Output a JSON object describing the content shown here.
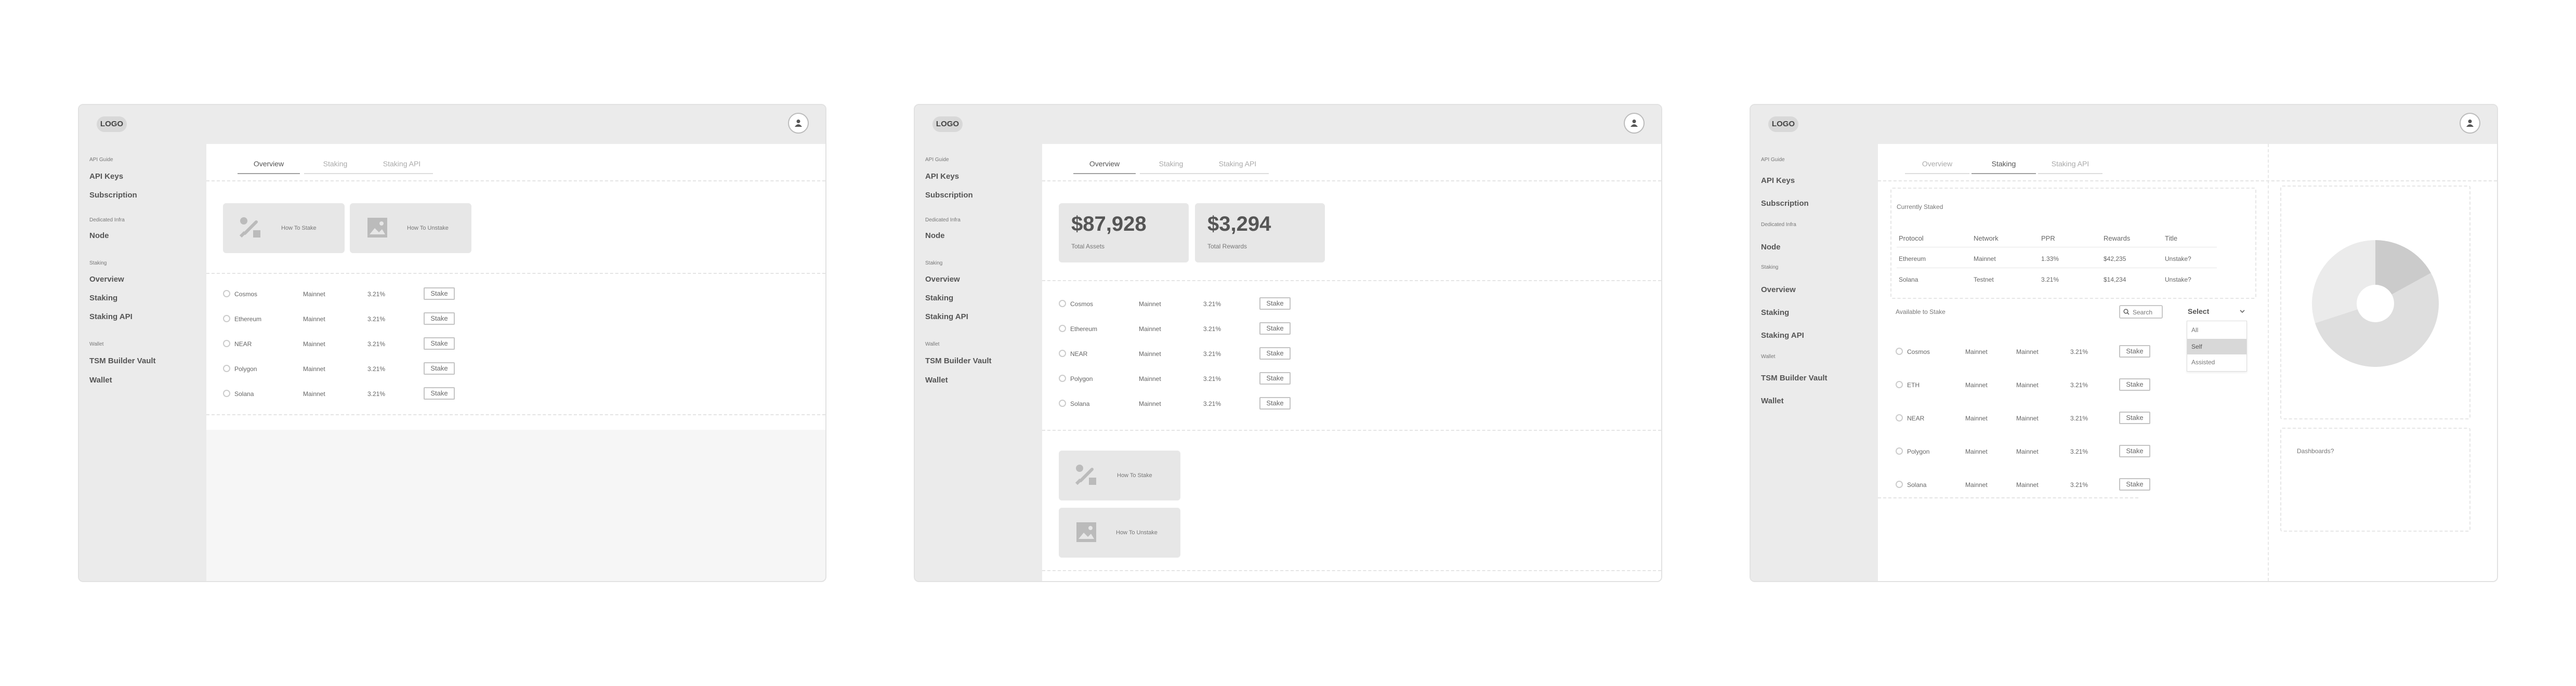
{
  "logo": "LOGO",
  "sidebar": {
    "api_guide": "API Guide",
    "api_keys": "API Keys",
    "subscription": "Subscription",
    "dedicated_infra": "Dedicated Infra",
    "node": "Node",
    "staking": "Staking",
    "overview": "Overview",
    "staking_item": "Staking",
    "staking_api": "Staking API",
    "wallet_header": "Wallet",
    "tsm_builder_vault": "TSM Builder Vault",
    "wallet": "Wallet"
  },
  "tabs": [
    "Overview",
    "Staking",
    "Staking API"
  ],
  "cards": {
    "how_to_stake": "How To Stake",
    "how_to_unstake": "How To Unstake"
  },
  "stats": {
    "total_assets_value": "$87,928",
    "total_assets_label": "Total Assets",
    "total_rewards_value": "$3,294",
    "total_rewards_label": "Total Rewards"
  },
  "stake_label": "Stake",
  "protocols": [
    {
      "name": "Cosmos",
      "network": "Mainnet",
      "apr": "3.21%"
    },
    {
      "name": "Ethereum",
      "network": "Mainnet",
      "apr": "3.21%"
    },
    {
      "name": "NEAR",
      "network": "Mainnet",
      "apr": "3.21%"
    },
    {
      "name": "Polygon",
      "network": "Mainnet",
      "apr": "3.21%"
    },
    {
      "name": "Solana",
      "network": "Mainnet",
      "apr": "3.21%"
    }
  ],
  "staking_page": {
    "currently_staked": "Currently Staked",
    "headers": [
      "Protocol",
      "Network",
      "PPR",
      "Rewards",
      "Title"
    ],
    "staked_rows": [
      {
        "protocol": "Ethereum",
        "network": "Mainnet",
        "ppr": "1.33%",
        "rewards": "$42,235",
        "title": "Unstake?"
      },
      {
        "protocol": "Solana",
        "network": "Testnet",
        "ppr": "3.21%",
        "rewards": "$14,234",
        "title": "Unstake?"
      }
    ],
    "available_to_stake": "Available to Stake",
    "search_placeholder": "Search",
    "select_label": "Select",
    "select_options": [
      "All",
      "Self",
      "Assisted"
    ],
    "selected_option": "Self",
    "available_rows": [
      {
        "name": "Cosmos",
        "col2": "Mainnet",
        "col3": "Mainnet",
        "apr": "3.21%"
      },
      {
        "name": "ETH",
        "col2": "Mainnet",
        "col3": "Mainnet",
        "apr": "3.21%"
      },
      {
        "name": "NEAR",
        "col2": "Mainnet",
        "col3": "Mainnet",
        "apr": "3.21%"
      },
      {
        "name": "Polygon",
        "col2": "Mainnet",
        "col3": "Mainnet",
        "apr": "3.21%"
      },
      {
        "name": "Solana",
        "col2": "Mainnet",
        "col3": "Mainnet",
        "apr": "3.21%"
      }
    ],
    "dashboards": "Dashboards?",
    "pie_colors": [
      "#cbcbcb",
      "#dedede",
      "#ebebeb"
    ],
    "pie_values": [
      0.17,
      0.53,
      0.3
    ]
  }
}
